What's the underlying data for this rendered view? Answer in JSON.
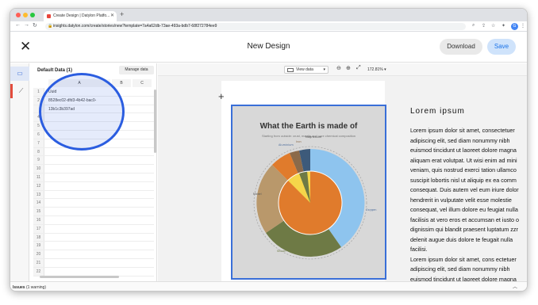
{
  "browser": {
    "tab_title": "Create Design | Datylon Platfo...",
    "url": "insights.datylon.com/create/stories/new?template=7a4a62db-73ae-493a-bdb7-68f272784ee9"
  },
  "header": {
    "title": "New Design",
    "download_label": "Download",
    "save_label": "Save"
  },
  "data_panel": {
    "title": "Default Data (1)",
    "manage_label": "Manage data",
    "columns": [
      "A",
      "B",
      "C"
    ],
    "rows": [
      {
        "n": "1",
        "a": "Uuid"
      },
      {
        "n": "2",
        "a": "8528ec02-dfd3-4b42-bac0-"
      },
      {
        "n": "",
        "a": "13b1c3b397ad"
      },
      {
        "n": "4",
        "a": ""
      },
      {
        "n": "5",
        "a": ""
      },
      {
        "n": "6",
        "a": ""
      },
      {
        "n": "7",
        "a": ""
      },
      {
        "n": "8",
        "a": ""
      },
      {
        "n": "9",
        "a": ""
      },
      {
        "n": "10",
        "a": ""
      },
      {
        "n": "11",
        "a": ""
      },
      {
        "n": "12",
        "a": ""
      },
      {
        "n": "13",
        "a": ""
      },
      {
        "n": "14",
        "a": ""
      },
      {
        "n": "15",
        "a": ""
      },
      {
        "n": "16",
        "a": ""
      },
      {
        "n": "17",
        "a": ""
      },
      {
        "n": "18",
        "a": ""
      },
      {
        "n": "19",
        "a": ""
      },
      {
        "n": "20",
        "a": ""
      },
      {
        "n": "21",
        "a": ""
      },
      {
        "n": "22",
        "a": ""
      }
    ]
  },
  "canvas_toolbar": {
    "view_data_label": "View data",
    "zoom_label": "172.81%"
  },
  "chart": {
    "title": "What the Earth is made of",
    "subtitle": "Starting from outside: crust, mantle and core chemical composition",
    "labels": [
      "Magnesium",
      "Iron",
      "Aluminium",
      "Oxygen",
      "Nickel",
      "Silicon"
    ]
  },
  "text_block": {
    "heading": "Lorem ipsum",
    "lines": [
      "Lorem ipsum dolor sit amet, consectetuer",
      "adipiscing elit, sed diam nonummy nibh",
      "euismod tincidunt ut laoreet dolore magna",
      "aliquam erat volutpat. Ut wisi enim ad mini",
      "veniam, quis nostrud exerci tation ullamco",
      "suscipit lobortis nisl ut aliquip ex ea comm",
      "consequat. Duis autem vel eum iriure dolor",
      "hendrerit in vulputate velit esse molestie",
      "consequat, vel illum dolore eu feugiat nulla",
      "facilisis at vero eros et accumsan et iusto o",
      "dignissim qui blandit praesent luptatum zzr",
      "delenit augue duis dolore te feugait nulla",
      "facilisi.",
      "Lorem ipsum dolor sit amet, cons ectetuer",
      "adipiscing elit, sed diam nonummy nibh",
      "euismod tincidunt ut laoreet dolore magna"
    ]
  },
  "issues": {
    "label": "Issues",
    "count": "(1 warning)"
  },
  "colors": {
    "accent": "#2b5de0",
    "orange": "#e07b2c",
    "olive": "#6e7a45",
    "blue": "#8ec4ee",
    "tan": "#b9986b",
    "yellow": "#f5d64a"
  }
}
